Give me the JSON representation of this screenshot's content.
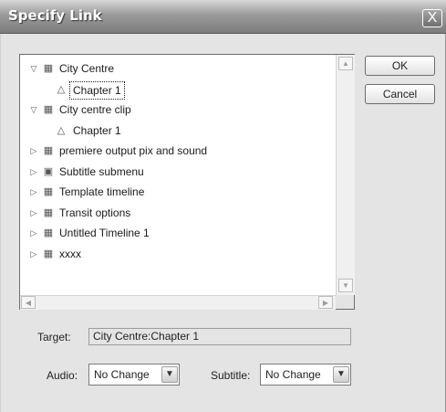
{
  "dialog": {
    "title": "Specify Link",
    "close_symbol": "X"
  },
  "tree": {
    "items": [
      {
        "label": "City Centre",
        "icon": "timeline-icon",
        "expander": "expanded"
      },
      {
        "label": "Chapter 1",
        "icon": "chapter-marker-icon",
        "selected": true
      },
      {
        "label": "City centre clip",
        "icon": "timeline-icon",
        "expander": "expanded"
      },
      {
        "label": "Chapter 1",
        "icon": "chapter-marker-icon"
      },
      {
        "label": "premiere output pix and sound",
        "icon": "timeline-icon",
        "expander": "collapsed"
      },
      {
        "label": "Subtitle submenu",
        "icon": "menu-icon",
        "expander": "collapsed"
      },
      {
        "label": "Template timeline",
        "icon": "timeline-icon",
        "expander": "collapsed"
      },
      {
        "label": "Transit options",
        "icon": "timeline-icon",
        "expander": "collapsed"
      },
      {
        "label": "Untitled Timeline 1",
        "icon": "timeline-icon",
        "expander": "collapsed"
      },
      {
        "label": "xxxx",
        "icon": "timeline-icon",
        "expander": "collapsed"
      }
    ]
  },
  "buttons": {
    "ok_label": "OK",
    "cancel_label": "Cancel"
  },
  "target": {
    "label": "Target:",
    "value": "City Centre:Chapter 1"
  },
  "audio": {
    "label": "Audio:",
    "value": "No Change"
  },
  "subtitle": {
    "label": "Subtitle:",
    "value": "No Change"
  },
  "glyphs": {
    "expanded": "▽",
    "collapsed": "▷",
    "timeline-icon": "▦",
    "menu-icon": "▣",
    "chapter-marker-icon": "△",
    "arrow_up": "▲",
    "arrow_down": "▼",
    "arrow_left": "◀",
    "arrow_right": "▶",
    "combo_arrow": "▼"
  }
}
